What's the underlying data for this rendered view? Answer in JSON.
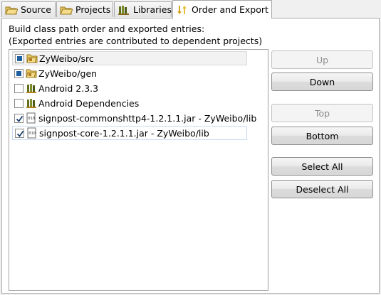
{
  "tabs": [
    {
      "label": "Source",
      "icon": "source-folder-icon",
      "active": false
    },
    {
      "label": "Projects",
      "icon": "projects-folder-icon",
      "active": false
    },
    {
      "label": "Libraries",
      "icon": "libraries-icon",
      "active": false
    },
    {
      "label": "Order and Export",
      "icon": "order-export-icon",
      "active": true
    }
  ],
  "description": {
    "line1": "Build class path order and exported entries:",
    "line2": "(Exported entries are contributed to dependent projects)"
  },
  "entries": [
    {
      "label": "ZyWeibo/src",
      "icon": "package-folder-icon",
      "checkbox": "filled",
      "selected": true
    },
    {
      "label": "ZyWeibo/gen",
      "icon": "package-folder-icon",
      "checkbox": "filled",
      "selected": false
    },
    {
      "label": "Android 2.3.3",
      "icon": "library-icon",
      "checkbox": "unchecked",
      "selected": false
    },
    {
      "label": "Android Dependencies",
      "icon": "library-icon",
      "checkbox": "unchecked",
      "selected": false
    },
    {
      "label": "signpost-commonshttp4-1.2.1.1.jar - ZyWeibo/lib",
      "icon": "jar-icon",
      "checkbox": "checked",
      "selected": false
    },
    {
      "label": "signpost-core-1.2.1.1.jar - ZyWeibo/lib",
      "icon": "jar-icon",
      "checkbox": "checked",
      "selected": false,
      "focused": true
    }
  ],
  "buttons": {
    "up": {
      "label": "Up",
      "enabled": false
    },
    "down": {
      "label": "Down",
      "enabled": true
    },
    "top": {
      "label": "Top",
      "enabled": false
    },
    "bottom": {
      "label": "Bottom",
      "enabled": true
    },
    "select_all": {
      "label": "Select All",
      "enabled": true
    },
    "deselect_all": {
      "label": "Deselect All",
      "enabled": true
    }
  }
}
